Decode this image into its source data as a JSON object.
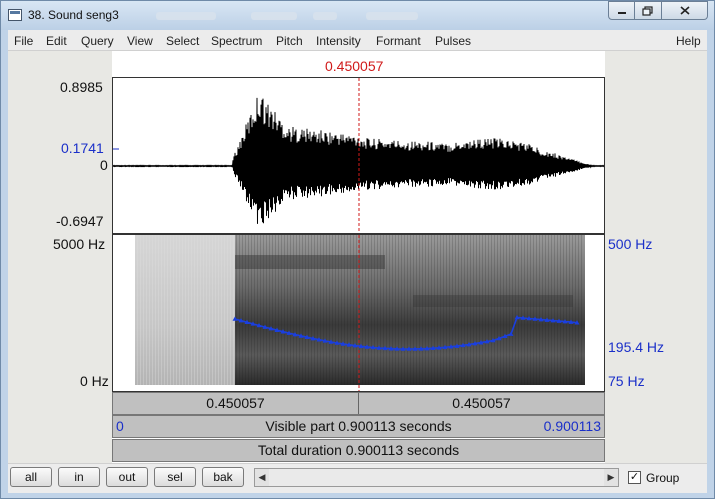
{
  "window": {
    "title": "38. Sound seng3",
    "ghost_tabs": [
      "Elapsed audit",
      "Undo silence",
      "Scan",
      "New Vendor"
    ]
  },
  "menu": [
    "File",
    "Edit",
    "Query",
    "View",
    "Select",
    "Spectrum",
    "Pitch",
    "Intensity",
    "Formant",
    "Pulses",
    "Help"
  ],
  "cursor_time": "0.450057",
  "waveform": {
    "top_label": "0.8985",
    "cursor_value": "0.1741",
    "zero_label": "0",
    "bottom_label": "-0.6947"
  },
  "spectrogram": {
    "top_left_label": "5000 Hz",
    "bottom_left_label": "0 Hz",
    "pitch_top_label": "500 Hz",
    "pitch_mid_label": "195.4 Hz",
    "pitch_bottom_label": "75 Hz"
  },
  "time_bar": {
    "left_label": "0.450057",
    "right_label": "0.450057"
  },
  "visible_bar": {
    "start": "0",
    "text": "Visible part 0.900113 seconds",
    "end": "0.900113"
  },
  "total_bar": {
    "text": "Total duration 0.900113 seconds"
  },
  "toolbar": {
    "buttons": [
      "all",
      "in",
      "out",
      "sel",
      "bak"
    ],
    "group_label": "Group",
    "group_checked": true
  },
  "colors": {
    "cursor": "#d01a1a",
    "blue_label": "#1a2fc9",
    "pitch_track": "#1a3fe0"
  }
}
